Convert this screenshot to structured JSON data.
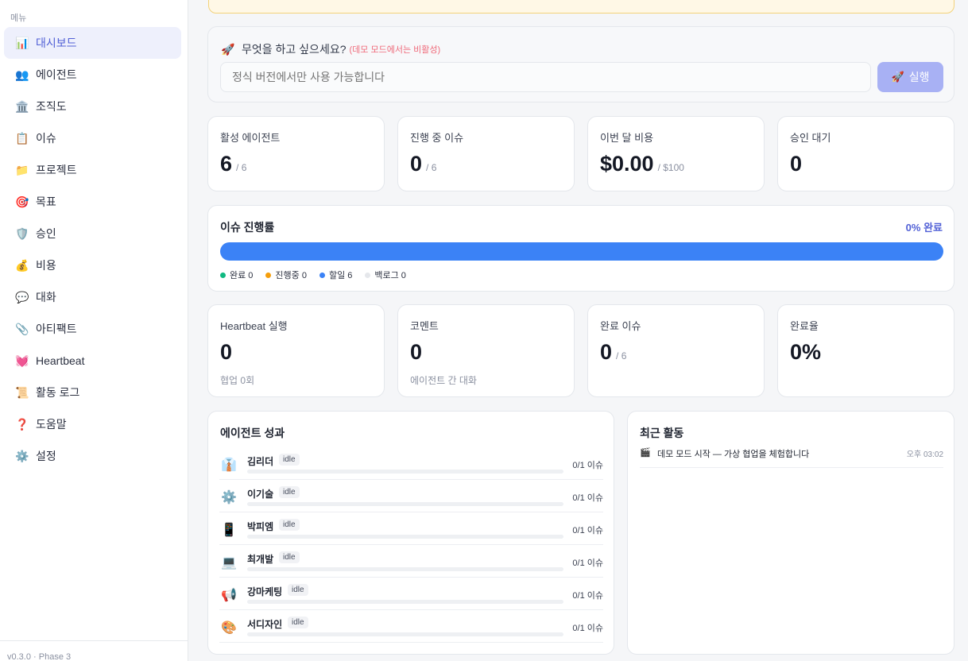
{
  "sidebar": {
    "header": "메뉴",
    "items": [
      {
        "label": "대시보드",
        "icon": "📊",
        "icon_name": "chart-icon"
      },
      {
        "label": "에이전트",
        "icon": "👥",
        "icon_name": "people-icon"
      },
      {
        "label": "조직도",
        "icon": "🏛️",
        "icon_name": "building-icon"
      },
      {
        "label": "이슈",
        "icon": "📋",
        "icon_name": "clipboard-icon"
      },
      {
        "label": "프로젝트",
        "icon": "📁",
        "icon_name": "folder-icon"
      },
      {
        "label": "목표",
        "icon": "🎯",
        "icon_name": "target-icon"
      },
      {
        "label": "승인",
        "icon": "🛡️",
        "icon_name": "shield-icon"
      },
      {
        "label": "비용",
        "icon": "💰",
        "icon_name": "money-bag-icon"
      },
      {
        "label": "대화",
        "icon": "💬",
        "icon_name": "chat-bubble-icon"
      },
      {
        "label": "아티팩트",
        "icon": "📎",
        "icon_name": "paperclip-icon"
      },
      {
        "label": "Heartbeat",
        "icon": "💓",
        "icon_name": "heart-icon"
      },
      {
        "label": "활동 로그",
        "icon": "📜",
        "icon_name": "scroll-icon"
      },
      {
        "label": "도움말",
        "icon": "❓",
        "icon_name": "question-icon"
      },
      {
        "label": "설정",
        "icon": "⚙️",
        "icon_name": "gear-icon"
      }
    ],
    "active_index": 0,
    "footer": "v0.3.0 · Phase 3"
  },
  "command": {
    "icon": "🚀",
    "title": "무엇을 하고 싶으세요?",
    "note": "(데모 모드에서는 비활성)",
    "placeholder": "정식 버전에서만 사용 가능합니다",
    "button_icon": "🚀",
    "button_label": "실행"
  },
  "stats_top": [
    {
      "label": "활성 에이전트",
      "value": "6",
      "sub": "/ 6"
    },
    {
      "label": "진행 중 이슈",
      "value": "0",
      "sub": "/ 6"
    },
    {
      "label": "이번 달 비용",
      "value": "$0.00",
      "sub": "/ $100"
    },
    {
      "label": "승인 대기",
      "value": "0",
      "sub": ""
    }
  ],
  "progress": {
    "title": "이슈 진행률",
    "percent_label": "0% 완료",
    "segments": [
      {
        "name": "완료",
        "count": 0,
        "color": "#10b981"
      },
      {
        "name": "진행중",
        "count": 0,
        "color": "#f59e0b"
      },
      {
        "name": "할일",
        "count": 6,
        "color": "#3b82f6"
      },
      {
        "name": "백로그",
        "count": 0,
        "color": "#e5e7eb"
      }
    ],
    "legend": [
      "완료 0",
      "진행중 0",
      "할일 6",
      "백로그 0"
    ]
  },
  "stats_bottom": [
    {
      "label": "Heartbeat 실행",
      "value": "0",
      "sub": "",
      "note": "협업 0회"
    },
    {
      "label": "코멘트",
      "value": "0",
      "sub": "",
      "note": "에이전트 간 대화"
    },
    {
      "label": "완료 이슈",
      "value": "0",
      "sub": "/ 6",
      "note": ""
    },
    {
      "label": "완료율",
      "value": "0%",
      "sub": "",
      "note": ""
    }
  ],
  "agents": {
    "title": "에이전트 성과",
    "rows": [
      {
        "name": "김리더",
        "status": "idle",
        "count": "0/1 이슈",
        "progress": 0,
        "icon": "👔",
        "icon_name": "necktie-icon"
      },
      {
        "name": "이기술",
        "status": "idle",
        "count": "0/1 이슈",
        "progress": 0,
        "icon": "⚙️",
        "icon_name": "gear-icon"
      },
      {
        "name": "박피엠",
        "status": "idle",
        "count": "0/1 이슈",
        "progress": 0,
        "icon": "📱",
        "icon_name": "phone-icon"
      },
      {
        "name": "최개발",
        "status": "idle",
        "count": "0/1 이슈",
        "progress": 0,
        "icon": "💻",
        "icon_name": "laptop-icon"
      },
      {
        "name": "강마케팅",
        "status": "idle",
        "count": "0/1 이슈",
        "progress": 0,
        "icon": "📢",
        "icon_name": "megaphone-icon"
      },
      {
        "name": "서디자인",
        "status": "idle",
        "count": "0/1 이슈",
        "progress": 0,
        "icon": "🎨",
        "icon_name": "palette-icon"
      }
    ]
  },
  "activity": {
    "title": "최근 활동",
    "items": [
      {
        "icon": "🎬",
        "icon_name": "clapperboard-icon",
        "text": "데모 모드 시작 — 가상 협업을 체험합니다",
        "time": "오후 03:02"
      }
    ]
  }
}
